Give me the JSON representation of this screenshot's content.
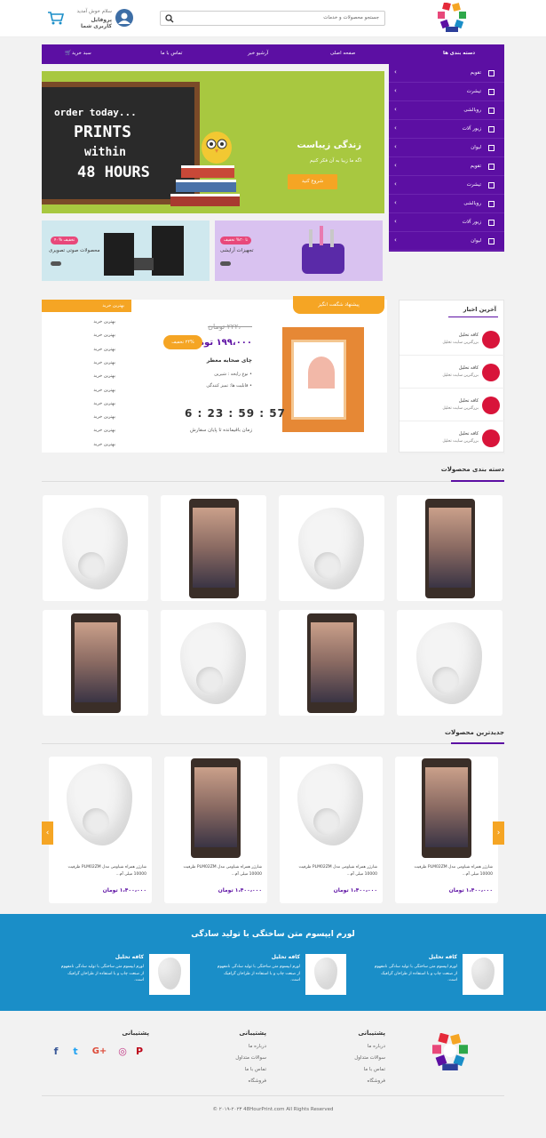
{
  "header": {
    "search_placeholder": "جستجو محصولات و خدمات",
    "welcome": "سلام خوش آمدید",
    "profile": "پروفایل کاربری شما"
  },
  "nav": {
    "categories": "دسته بندی ها",
    "home": "صفحه اصلی",
    "archive": "آرشیو خبر",
    "contact": "تماس با ما",
    "cart": "سبد خرید"
  },
  "categories": [
    "تقویم",
    "تیشرت",
    "روبالشی",
    "زیور آلات",
    "لیوان",
    "تقویم",
    "تیشرت",
    "روبالشی",
    "زیور آلات",
    "لیوان"
  ],
  "banner": {
    "board_l1": "order today...",
    "board_l2": "PRINTS",
    "board_l3": "within",
    "board_l4": "48 HOURS",
    "title": "زندگی زیباست",
    "subtitle": "اگه ما زیبا به آن فکر کنیم",
    "button": "شروع کنید"
  },
  "promos": [
    {
      "label": "محصولات صوتی تصویری",
      "badge": "۴۰% تخفیف"
    },
    {
      "label": "تجهیزات آرایشی",
      "badge": "تا ۳۰% تخفیف"
    }
  ],
  "offer": {
    "side_header": "بهترین خرید",
    "side_items": [
      "بهترین خرید",
      "بهترین خرید",
      "بهترین خرید",
      "بهترین خرید",
      "بهترین خرید",
      "بهترین خرید",
      "بهترین خرید",
      "بهترین خرید",
      "بهترین خرید",
      "بهترین خرید"
    ],
    "tag": "پیشنهاد شگفت انگیز",
    "price_old": "۲۲۲،۰۰۰ تومان",
    "price_new": "۱۹۹،۰۰۰ تومان",
    "discount": "۲۴% تخفیف",
    "product": "چای صحابه معطر",
    "features": [
      "نوع رایحه : شیرین",
      "قابلیت ها: تمیز کنندگی"
    ],
    "timer": "6 : 23 : 59 : 57",
    "timer_label": "زمان باقیمانده تا پایان سفارش"
  },
  "news": {
    "title": "آخرین اخبار",
    "items": [
      {
        "t1": "کافه تحلیل",
        "t2": "بزرگترین سایت تحلیل"
      },
      {
        "t1": "کافه تحلیل",
        "t2": "بزرگترین سایت تحلیل"
      },
      {
        "t1": "کافه تحلیل",
        "t2": "بزرگترین سایت تحلیل"
      },
      {
        "t1": "کافه تحلیل",
        "t2": "بزرگترین سایت تحلیل"
      }
    ]
  },
  "sections": {
    "categories": "دسته بندی محصولات",
    "newest": "جدیدترین محصولات"
  },
  "newest": [
    {
      "name": "شارژر همراه شیاومی مدل PLM02ZM ظرفیت 10000 میلی آم...",
      "price": "۱،۴۰۰،۰۰۰ تومان"
    },
    {
      "name": "شارژر همراه شیاومی مدل PLM02ZM ظرفیت 10000 میلی آم...",
      "price": "۱،۴۰۰،۰۰۰ تومان"
    },
    {
      "name": "شارژر همراه شیاومی مدل PLM02ZM ظرفیت 10000 میلی آم...",
      "price": "۱،۴۰۰،۰۰۰ تومان"
    },
    {
      "name": "شارژر همراه شیاومی مدل PLM02ZM ظرفیت 10000 میلی آم...",
      "price": "۱،۴۰۰،۰۰۰ تومان"
    }
  ],
  "features": {
    "title": "لورم ایپسوم متن ساختگی با تولید سادگی",
    "items": [
      {
        "t1": "کافه تحلیل",
        "t2": "لورم ایپسوم متن ساختگی با تولید سادگی نامفهوم از صنعت چاپ و با استفاده از طراحان گرافیک است."
      },
      {
        "t1": "کافه تحلیل",
        "t2": "لورم ایپسوم متن ساختگی با تولید سادگی نامفهوم از صنعت چاپ و با استفاده از طراحان گرافیک است."
      },
      {
        "t1": "کافه تحلیل",
        "t2": "لورم ایپسوم متن ساختگی با تولید سادگی نامفهوم از صنعت چاپ و با استفاده از طراحان گرافیک است."
      }
    ]
  },
  "footer": {
    "col_title": "پشتیبانی",
    "links1": [
      "درباره ما",
      "سوالات متداول",
      "تماس با ما",
      "فروشگاه"
    ],
    "links2": [
      "درباره ما",
      "سوالات متداول",
      "تماس با ما",
      "فروشگاه"
    ],
    "social_title": "پشتیبانی",
    "copyright": "© ۲۰۱۹-۲۰۲۳ 48HourPrint.com All Rights Reserved"
  },
  "colors": {
    "primary": "#5c0fa3",
    "accent": "#f5a524",
    "blue": "#1a8ec8"
  }
}
